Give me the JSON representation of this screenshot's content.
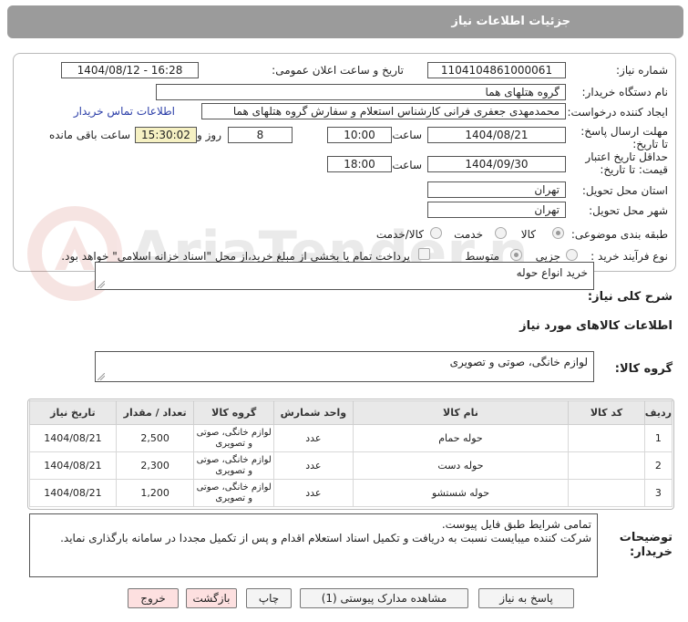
{
  "title": "جزئیات اطلاعات نیاز",
  "form": {
    "need_number_label": "شماره نیاز:",
    "need_number": "1104104861000061",
    "announce_label": "تاریخ و ساعت اعلان عمومی:",
    "announce_value": "1404/08/12 - 16:28",
    "buyer_org_label": "نام دستگاه خریدار:",
    "buyer_org": "گروه هتلهای هما",
    "requester_label": "ایجاد کننده درخواست:",
    "requester": "محمدمهدی جعفری فرانی کارشناس استعلام و سفارش گروه هتلهای هما",
    "contact_link": "اطلاعات تماس خریدار",
    "deadline_label": "مهلت ارسال پاسخ: تا تاریخ:",
    "deadline_date": "1404/08/21",
    "time_label": "ساعت",
    "deadline_time": "10:00",
    "days_count": "8",
    "days_and_label": "روز و",
    "remaining_time": "15:30:02",
    "remaining_label": "ساعت باقی مانده",
    "validity_label": "حداقل تاریخ اعتبار قیمت: تا تاریخ:",
    "validity_date": "1404/09/30",
    "validity_time": "18:00",
    "province_label": "استان محل تحویل:",
    "province": "تهران",
    "city_label": "شهر محل تحویل:",
    "city": "تهران",
    "category_label": "طبقه بندی موضوعی:",
    "category_options": [
      "کالا",
      "خدمت",
      "کالا/خدمت"
    ],
    "process_label": "نوع فرآیند خرید :",
    "process_options": [
      "جزیی",
      "متوسط"
    ],
    "payment_note": "پرداخت تمام یا بخشی از مبلغ خرید،از محل \"اسناد خزانه اسلامی\" خواهد بود."
  },
  "summary": {
    "label": "شرح کلی نیاز:",
    "value": "خرید انواع حوله"
  },
  "goods": {
    "section_title": "اطلاعات کالاهای مورد نیاز",
    "group_label": "گروه کالا:",
    "group_value": "لوازم خانگی، صوتی و تصویری"
  },
  "table": {
    "headers": [
      "ردیف",
      "کد کالا",
      "نام کالا",
      "واحد شمارش",
      "گروه کالا",
      "تعداد / مقدار",
      "تاریخ نیاز"
    ],
    "rows": [
      {
        "idx": "1",
        "code": "",
        "name": "حوله حمام",
        "unit": "عدد",
        "group": "لوازم خانگی، صوتی و تصویری",
        "qty": "2,500",
        "date": "1404/08/21"
      },
      {
        "idx": "2",
        "code": "",
        "name": "حوله دست",
        "unit": "عدد",
        "group": "لوازم خانگی، صوتی و تصویری",
        "qty": "2,300",
        "date": "1404/08/21"
      },
      {
        "idx": "3",
        "code": "",
        "name": "حوله شستشو",
        "unit": "عدد",
        "group": "لوازم خانگی، صوتی و تصویری",
        "qty": "1,200",
        "date": "1404/08/21"
      }
    ]
  },
  "notes": {
    "label": "توضیحات خریدار:",
    "line1": "تمامی شرایط طبق فایل پیوست.",
    "line2": "شرکت کننده میبایست نسبت به دریافت و تکمیل اسناد استعلام اقدام و پس از تکمیل مجددا در سامانه بارگذاری نماید."
  },
  "buttons": {
    "reply": "پاسخ به نیاز",
    "attachments": "مشاهده مدارک پیوستی (1)",
    "print": "چاپ",
    "back": "بازگشت",
    "exit": "خروج"
  },
  "watermark": "AriaTender.neT"
}
